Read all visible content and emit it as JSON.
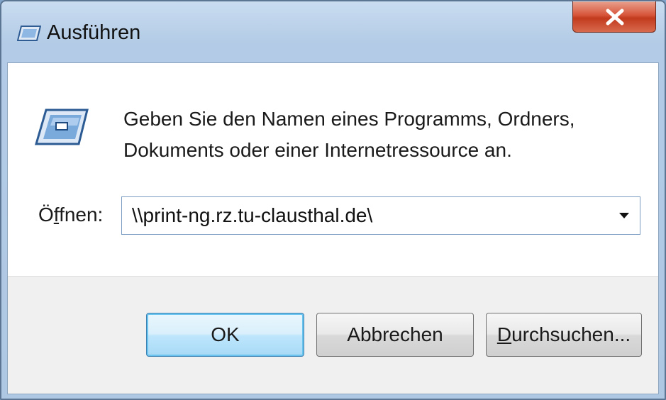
{
  "window": {
    "title": "Ausführen"
  },
  "dialog": {
    "description_line1": "Geben Sie den Namen eines Programms, Ordners,",
    "description_line2": "Dokuments oder einer Internetressource an.",
    "open_label_prefix": "Ö",
    "open_label_mnemonic": "f",
    "open_label_suffix": "fnen:",
    "open_value": "\\\\print-ng.rz.tu-clausthal.de\\"
  },
  "buttons": {
    "ok": "OK",
    "cancel": "Abbrechen",
    "browse_mnemonic": "D",
    "browse_rest": "urchsuchen..."
  },
  "icons": {
    "title": "run-icon",
    "close": "close-icon",
    "dialog": "run-icon",
    "dropdown": "chevron-down-icon"
  },
  "colors": {
    "close_button": "#c23a1e",
    "default_button_border": "#3c7fb1",
    "content_bg": "#ffffff",
    "footer_bg": "#f0f0f0"
  }
}
